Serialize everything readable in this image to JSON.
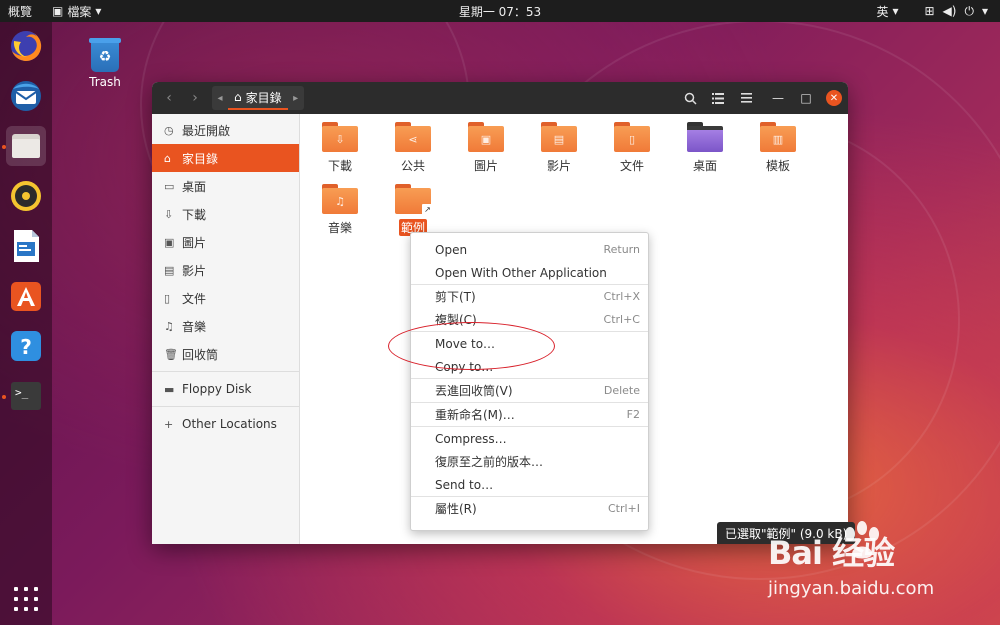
{
  "topbar": {
    "activities": "概覽",
    "app_menu": "檔案",
    "clock": "星期一 07：53",
    "input_method": "英"
  },
  "desktop": {
    "trash_label": "Trash"
  },
  "window": {
    "path_crumb": "家目錄"
  },
  "sidebar": {
    "items": [
      {
        "label": "最近開啟",
        "icon": "clock-icon"
      },
      {
        "label": "家目錄",
        "icon": "home-icon"
      },
      {
        "label": "桌面",
        "icon": "desktop-icon"
      },
      {
        "label": "下載",
        "icon": "download-icon"
      },
      {
        "label": "圖片",
        "icon": "image-icon"
      },
      {
        "label": "影片",
        "icon": "film-icon"
      },
      {
        "label": "文件",
        "icon": "document-icon"
      },
      {
        "label": "音樂",
        "icon": "music-icon"
      },
      {
        "label": "回收筒",
        "icon": "trash-icon"
      }
    ],
    "devices": [
      {
        "label": "Floppy Disk",
        "icon": "drive-icon"
      }
    ],
    "other": {
      "label": "Other Locations",
      "icon": "plus-icon"
    }
  },
  "files": [
    {
      "label": "下載",
      "icon": "download-icon"
    },
    {
      "label": "公共",
      "icon": "share-icon"
    },
    {
      "label": "圖片",
      "icon": "image-icon"
    },
    {
      "label": "影片",
      "icon": "film-icon"
    },
    {
      "label": "文件",
      "icon": "document-icon"
    },
    {
      "label": "桌面",
      "icon": "desktop-folder-icon"
    },
    {
      "label": "模板",
      "icon": "template-icon"
    },
    {
      "label": "音樂",
      "icon": "music-icon"
    },
    {
      "label": "範例",
      "icon": "link-folder-icon"
    }
  ],
  "context_menu": {
    "items": [
      {
        "label": "Open",
        "accel": "Return"
      },
      {
        "label": "Open With Other Application",
        "accel": ""
      },
      {
        "label": "剪下(T)",
        "accel": "Ctrl+X"
      },
      {
        "label": "複製(C)",
        "accel": "Ctrl+C"
      },
      {
        "label": "Move to…",
        "accel": ""
      },
      {
        "label": "Copy to…",
        "accel": ""
      },
      {
        "label": "丟進回收筒(V)",
        "accel": "Delete"
      },
      {
        "label": "重新命名(M)…",
        "accel": "F2"
      },
      {
        "label": "Compress…",
        "accel": ""
      },
      {
        "label": "復原至之前的版本…",
        "accel": ""
      },
      {
        "label": "Send to…",
        "accel": ""
      },
      {
        "label": "屬性(R)",
        "accel": "Ctrl+I"
      }
    ]
  },
  "statusbar": {
    "text": "已選取\"範例\" (9.0 kB)"
  },
  "watermark": {
    "brand": "Bai 经验",
    "url": "jingyan.baidu.com"
  },
  "colors": {
    "accent": "#e95420",
    "highlight_circle": "#d8202a"
  }
}
